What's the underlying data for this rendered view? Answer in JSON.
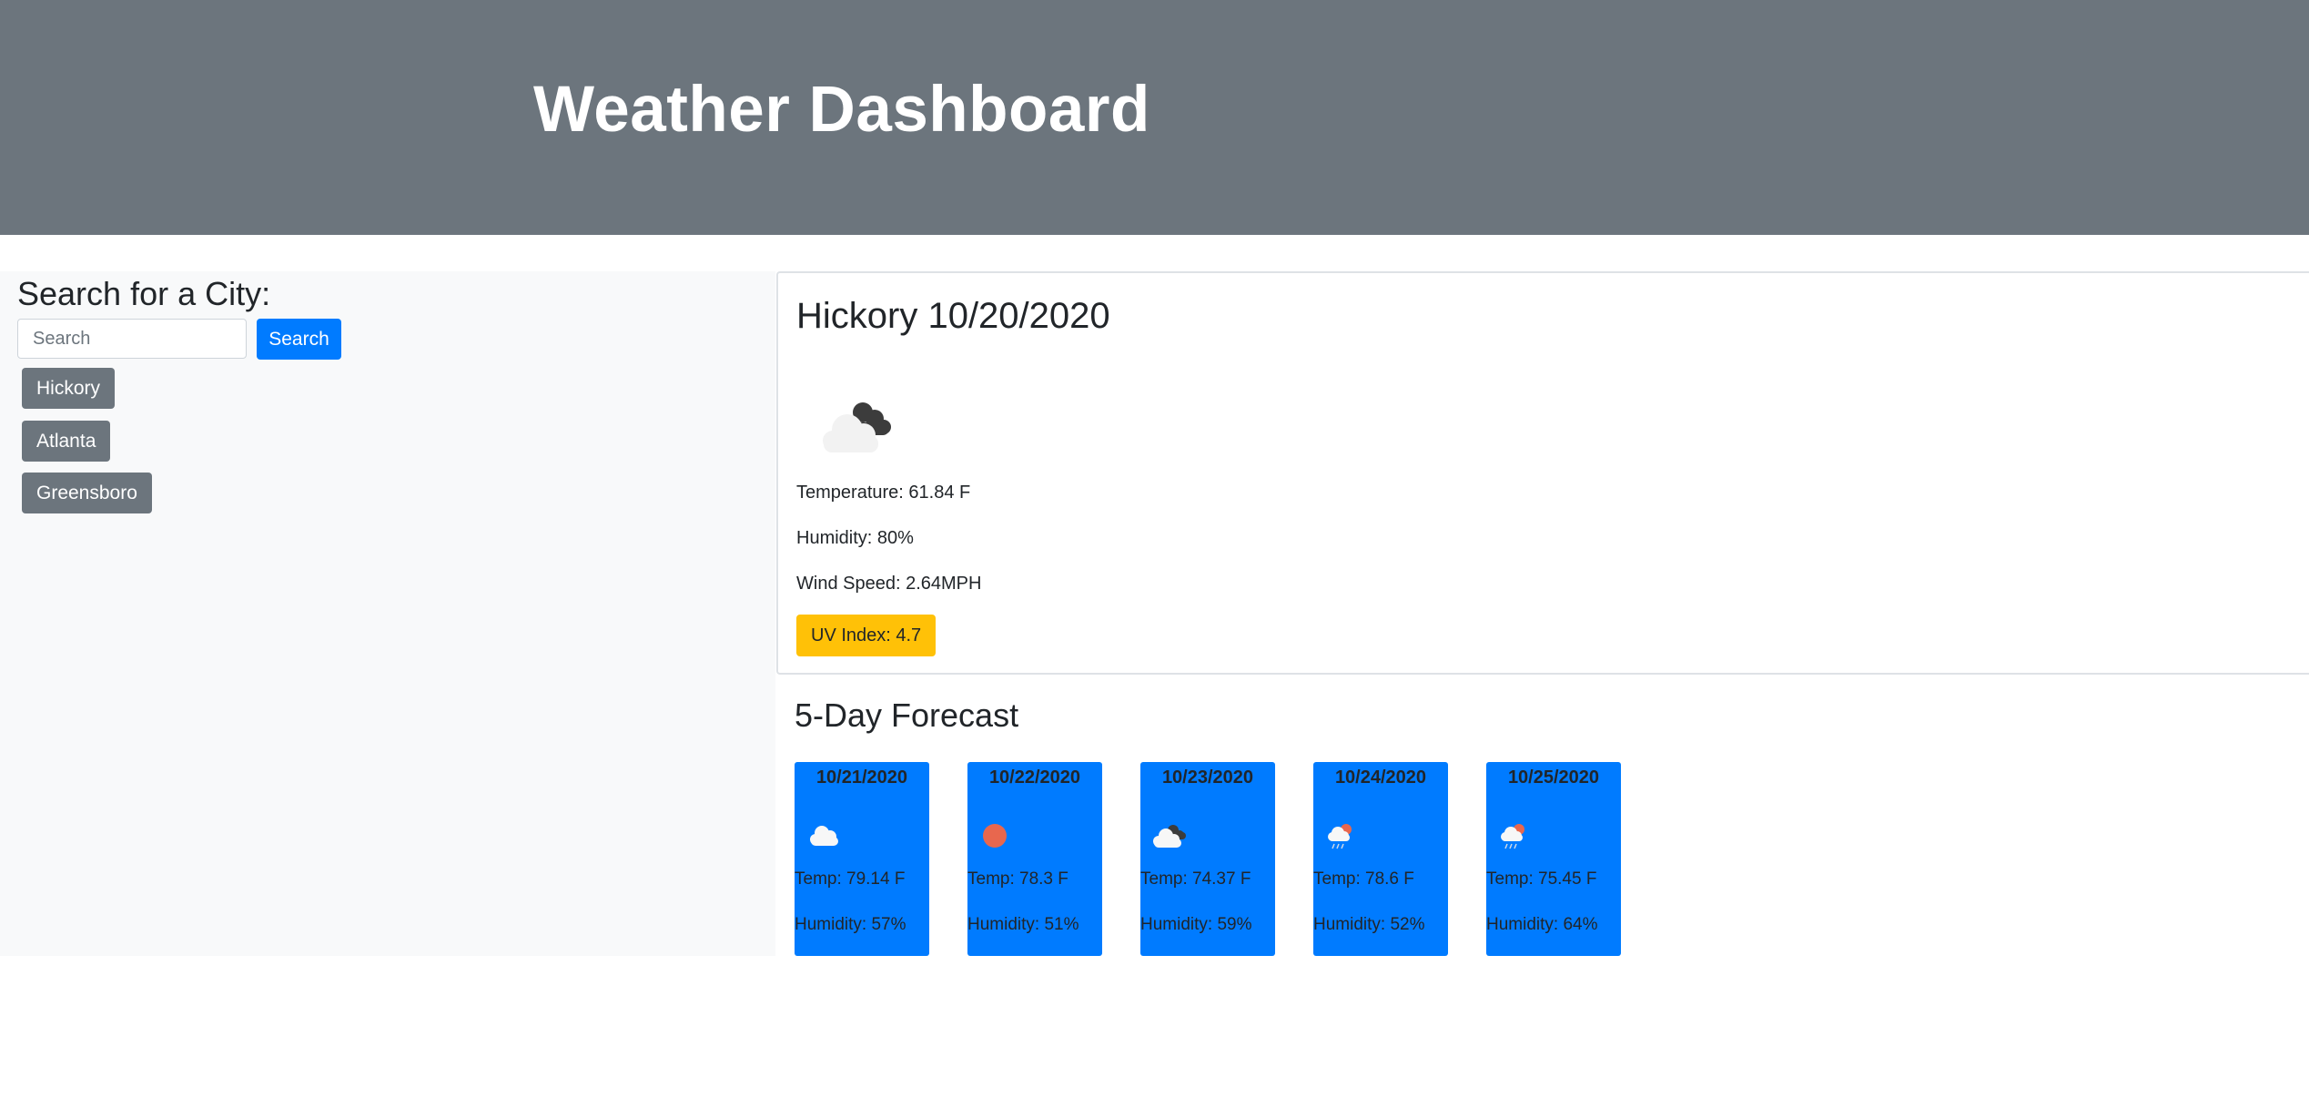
{
  "header": {
    "title": "Weather Dashboard"
  },
  "sidebar": {
    "heading": "Search for a City:",
    "search": {
      "placeholder": "Search",
      "value": ""
    },
    "search_button": "Search",
    "history": [
      "Hickory",
      "Atlanta",
      "Greensboro"
    ]
  },
  "current": {
    "title": "Hickory 10/20/2020",
    "icon": "broken-clouds-icon",
    "temperature": "Temperature: 61.84 F",
    "humidity": "Humidity: 80%",
    "wind": "Wind Speed: 2.64MPH",
    "uv": "UV Index: 4.7"
  },
  "forecast": {
    "title": "5-Day Forecast",
    "days": [
      {
        "date": "10/21/2020",
        "icon": "cloud-icon",
        "temp": "Temp: 79.14 F",
        "humidity": "Humidity: 57%"
      },
      {
        "date": "10/22/2020",
        "icon": "sun-icon",
        "temp": "Temp: 78.3 F",
        "humidity": "Humidity: 51%"
      },
      {
        "date": "10/23/2020",
        "icon": "broken-clouds-icon",
        "temp": "Temp: 74.37 F",
        "humidity": "Humidity: 59%"
      },
      {
        "date": "10/24/2020",
        "icon": "rain-icon",
        "temp": "Temp: 78.6 F",
        "humidity": "Humidity: 52%"
      },
      {
        "date": "10/25/2020",
        "icon": "rain-icon",
        "temp": "Temp: 75.45 F",
        "humidity": "Humidity: 64%"
      }
    ]
  },
  "colors": {
    "header_bg": "#6c757d",
    "primary": "#007bff",
    "secondary": "#6c757d",
    "warning": "#ffc107",
    "sidebar_bg": "#f8f9fa"
  }
}
